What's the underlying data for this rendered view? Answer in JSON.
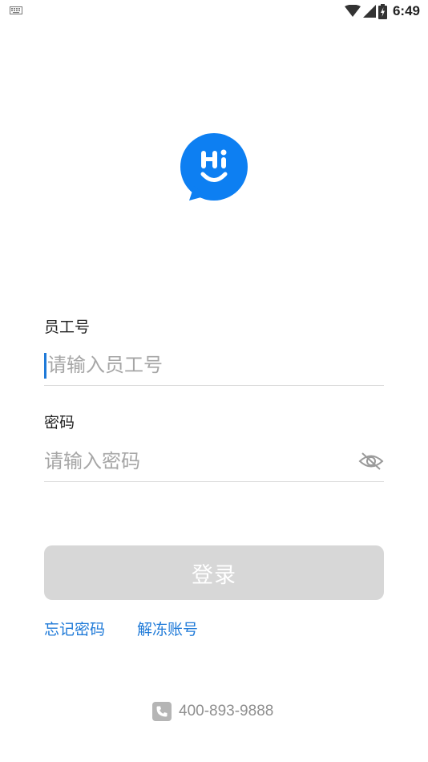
{
  "status_bar": {
    "time": "6:49",
    "icons": [
      "keyboard-icon",
      "wifi-icon",
      "cell-signal-icon",
      "battery-charging-icon"
    ]
  },
  "logo": {
    "text": "Hi",
    "icon": "hi-chat-bubble-logo",
    "color": "#0d7ff2"
  },
  "form": {
    "employee_id": {
      "label": "员工号",
      "placeholder": "请输入员工号",
      "value": ""
    },
    "password": {
      "label": "密码",
      "placeholder": "请输入密码",
      "value": "",
      "toggle_icon": "eye-hidden-icon"
    }
  },
  "login_button": {
    "label": "登录",
    "enabled": false,
    "bg_color": "#d7d7d7"
  },
  "links": {
    "forgot_password": "忘记密码",
    "unfreeze_account": "解冻账号",
    "color": "#1f7ad8"
  },
  "footer": {
    "phone_icon": "phone-icon",
    "phone": "400-893-9888"
  }
}
